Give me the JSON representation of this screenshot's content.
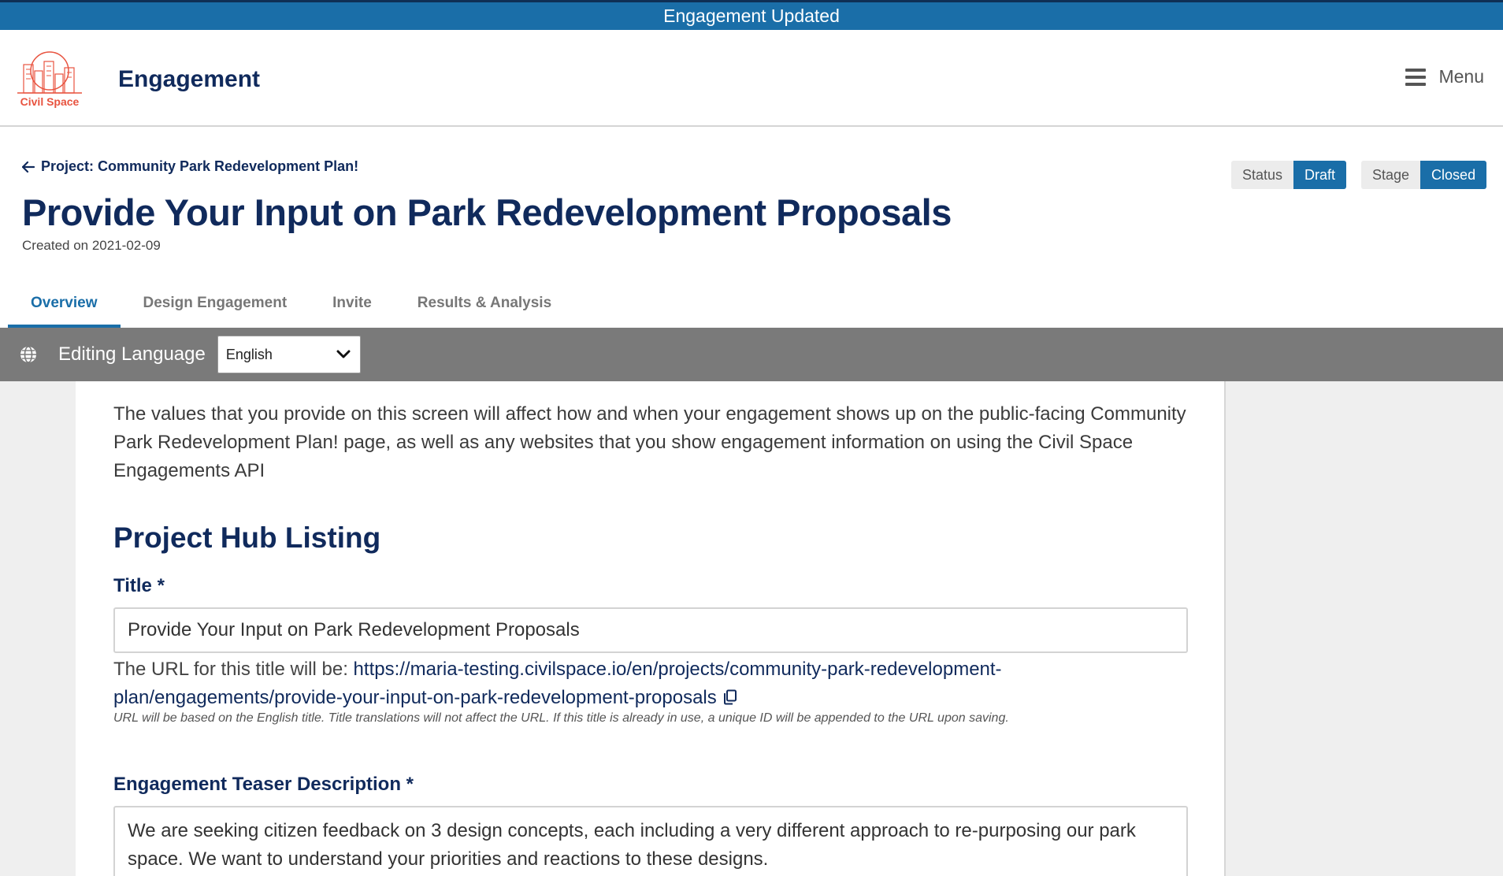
{
  "banner": {
    "text": "Engagement Updated"
  },
  "header": {
    "logo_text": "Civil Space",
    "app_title": "Engagement",
    "menu_label": "Menu"
  },
  "project": {
    "back_label": "Project: Community Park Redevelopment Plan!",
    "title": "Provide Your Input on Park Redevelopment Proposals",
    "created": "Created on 2021-02-09",
    "status_key": "Status",
    "status_value": "Draft",
    "stage_key": "Stage",
    "stage_value": "Closed"
  },
  "tabs": [
    {
      "label": "Overview",
      "active": true
    },
    {
      "label": "Design Engagement",
      "active": false
    },
    {
      "label": "Invite",
      "active": false
    },
    {
      "label": "Results & Analysis",
      "active": false
    }
  ],
  "language_bar": {
    "label": "Editing Language",
    "selected": "English"
  },
  "content": {
    "intro": "The values that you provide on this screen will affect how and when your engagement shows up on the public-facing Community Park Redevelopment Plan! page, as well as any websites that you show engagement information on using the Civil Space Engagements API",
    "section_title": "Project Hub Listing",
    "title_label": "Title *",
    "title_value": "Provide Your Input on Park Redevelopment Proposals",
    "url_prefix": "The URL for this title will be: ",
    "url_value": "https://maria-testing.civilspace.io/en/projects/community-park-redevelopment-plan/engagements/provide-your-input-on-park-redevelopment-proposals",
    "url_note": "URL will be based on the English title. Title translations will not affect the URL. If this title is already in use, a unique ID will be appended to the URL upon saving.",
    "teaser_label": "Engagement Teaser Description *",
    "teaser_value": "We are seeking citizen feedback on 3  design concepts, each including a very different approach to re-purposing our park space. We want to understand your priorities and reactions to these designs."
  },
  "colors": {
    "brand_navy": "#102a5c",
    "accent_blue": "#1a6ea8",
    "logo_red": "#e8533f",
    "language_bar": "#7a7a7a"
  },
  "icons": {
    "back": "arrow-left-icon",
    "menu": "hamburger-icon",
    "globe": "globe-icon",
    "select": "chevron-down-icon",
    "copy": "copy-icon"
  }
}
